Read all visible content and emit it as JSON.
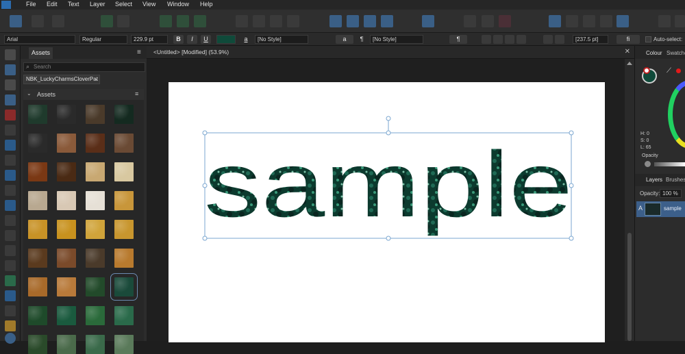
{
  "menu": [
    "File",
    "Edit",
    "Text",
    "Layer",
    "Select",
    "View",
    "Window",
    "Help"
  ],
  "context_toolbar": {
    "font_family": "Arial",
    "font_style": "Regular",
    "font_size": "229.9 pt",
    "bold": "B",
    "italic": "I",
    "underline": "U",
    "char_style_glyph": "a",
    "char_style": "[No Style]",
    "para_style_glyph": "a",
    "pilcrow": "¶",
    "para_style": "[No Style]",
    "pilcrow_right": "¶",
    "tracking": "[237.5 pt]",
    "ligature": "fi",
    "auto_select": "Auto-select:"
  },
  "assets": {
    "tab": "Assets",
    "search_placeholder": "Search",
    "category": "NBK_LuckyCharmsCloverPat",
    "subpanel_title": "Assets",
    "swatch_colors": [
      [
        "#1f3a2c",
        "#2a2a2a",
        "#4a3a2a",
        "#142a20"
      ],
      [
        "#2a2a2a",
        "#8a5a3a",
        "#5a2e18",
        "#6a4a34"
      ],
      [
        "#7a3814",
        "#4a2a14",
        "#c8a872",
        "#d8c8a0"
      ],
      [
        "#b8a890",
        "#d8c8b4",
        "#e6e0d6",
        "#c8963a"
      ],
      [
        "#c89226",
        "#c8921e",
        "#d0a43a",
        "#c8962e"
      ],
      [
        "#5a3a1e",
        "#7a4a2a",
        "#4a3a2a",
        "#b87a2e"
      ],
      [
        "#a86a2a",
        "#b87a3a",
        "#224a2a",
        "#1a4a3a"
      ],
      [
        "#1e4a2a",
        "#1a5a3e",
        "#2a6a3a",
        "#2a6a4a"
      ],
      [
        "#2a4a2a",
        "#4a6a4a",
        "#3a6a4a",
        "#5a7a5a"
      ]
    ]
  },
  "document": {
    "title": "<Untitled> [Modified] (53.9%)",
    "close_glyph": "✕",
    "sample_text": "sample",
    "fill_color": "#0f4a3a"
  },
  "right_panel": {
    "colour_tab": "Colour",
    "swatches_tab": "Swatche",
    "h": "H: 0",
    "s": "S: 0",
    "l": "L: 65",
    "opacity_label": "Opacity",
    "layers_tab": "Layers",
    "brushes_tab": "Brushes",
    "layer_opacity_label": "Opacity:",
    "layer_opacity_value": "100 %",
    "layer_name": "sample",
    "layer_letter": "A"
  }
}
